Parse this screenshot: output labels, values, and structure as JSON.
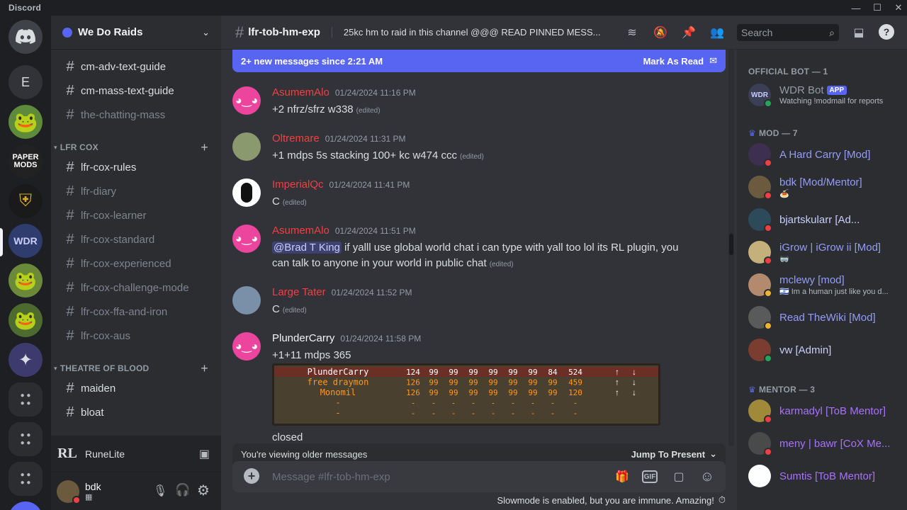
{
  "titlebar": {
    "app": "Discord"
  },
  "guild_home_letter": "E",
  "server": {
    "name": "We Do Raids"
  },
  "channels": {
    "top": [
      "cm-adv-text-guide",
      "cm-mass-text-guide",
      "the-chatting-mass"
    ],
    "cat1": {
      "name": "LFR COX",
      "items": [
        "lfr-cox-rules",
        "lfr-diary",
        "lfr-cox-learner",
        "lfr-cox-standard",
        "lfr-cox-experienced",
        "lfr-cox-challenge-mode",
        "lfr-cox-ffa-and-iron",
        "lfr-cox-aus"
      ]
    },
    "cat2": {
      "name": "THEATRE OF BLOOD",
      "items": [
        "maiden",
        "bloat"
      ]
    }
  },
  "activity": {
    "name": "RuneLite"
  },
  "user": {
    "name": "bdk"
  },
  "channel_header": {
    "name": "lfr-tob-hm-exp",
    "topic": "25kc hm to raid in this channel @@@ READ PINNED MESS...",
    "search_placeholder": "Search"
  },
  "new_messages_bar": {
    "text": "2+ new messages since 2:21 AM",
    "action": "Mark As Read"
  },
  "messages": [
    {
      "author": "AsumemAlo",
      "color": "#f23f43",
      "time": "01/24/2024 11:16 PM",
      "text": "+2 nfrz/sfrz  w338",
      "edited": "(edited)"
    },
    {
      "author": "Oltremare",
      "color": "#f23f43",
      "time": "01/24/2024 11:31 PM",
      "text": "+1 mdps 5s stacking 100+ kc w474 ccc",
      "edited": "(edited)"
    },
    {
      "author": "ImperialQc",
      "color": "#f23f43",
      "time": "01/24/2024 11:41 PM",
      "text": "C",
      "edited": "(edited)"
    },
    {
      "author": "AsumemAlo",
      "color": "#f23f43",
      "time": "01/24/2024 11:51 PM",
      "mention": "@Brad T King",
      "text": " if yalll use global world chat i can type with yall too lol its RL plugin, you can talk to anyone in your world in public chat",
      "edited": "(edited)"
    },
    {
      "author": "Large Tater",
      "color": "#f23f43",
      "time": "01/24/2024 11:52 PM",
      "text": "C",
      "edited": "(edited)"
    },
    {
      "author": "PlunderCarry",
      "color": "#dbdee1",
      "time": "01/24/2024 11:58 PM",
      "text": "+1+11 mdps 365",
      "after": "closed"
    }
  ],
  "embed_rows": [
    {
      "name": "PlunderCarry",
      "vals": [
        "124",
        "99",
        "99",
        "99",
        "99",
        "99",
        "99",
        "84",
        "524"
      ]
    },
    {
      "name": "free draymon",
      "vals": [
        "126",
        "99",
        "99",
        "99",
        "99",
        "99",
        "99",
        "99",
        "459"
      ]
    },
    {
      "name": "Monomil",
      "vals": [
        "126",
        "99",
        "99",
        "99",
        "99",
        "99",
        "99",
        "99",
        "120"
      ]
    }
  ],
  "older_bar": {
    "text": "You're viewing older messages",
    "action": "Jump To Present"
  },
  "composer": {
    "placeholder": "Message #lfr-tob-hm-exp"
  },
  "slowmode": "Slowmode is enabled, but you are immune. Amazing!",
  "members": {
    "sections": [
      {
        "title": "OFFICIAL BOT — 1"
      },
      {
        "title": "MOD — 7"
      },
      {
        "title": "MENTOR — 3"
      }
    ],
    "bot": {
      "name": "WDR Bot",
      "tag": "APP",
      "status": "Watching !modmail for reports",
      "color": "#949ba4"
    },
    "mods": [
      {
        "name": "A Hard Carry [Mod]",
        "color": "#949cf7",
        "status": ""
      },
      {
        "name": "bdk [Mod/Mentor]",
        "color": "#949cf7",
        "status": "🍝"
      },
      {
        "name": "bjartskularr [Ad...",
        "color": "#c9cdfb",
        "status": ""
      },
      {
        "name": "iGrow | iGrow ii [Mod]",
        "color": "#949cf7",
        "status": "🥽"
      },
      {
        "name": "mclewy [mod]",
        "color": "#949cf7",
        "status": "🇮🇱 Im a human just like you d..."
      },
      {
        "name": "Read TheWiki [Mod]",
        "color": "#949cf7",
        "status": ""
      },
      {
        "name": "vw [Admin]",
        "color": "#c9cdfb",
        "status": ""
      }
    ],
    "mentors": [
      {
        "name": "karmadyl [ToB Mentor]",
        "color": "#a970ff",
        "status": ""
      },
      {
        "name": "meny | bawr [CoX Me...",
        "color": "#a970ff",
        "status": ""
      },
      {
        "name": "Sumtis [ToB Mentor]",
        "color": "#a970ff",
        "status": ""
      }
    ]
  }
}
